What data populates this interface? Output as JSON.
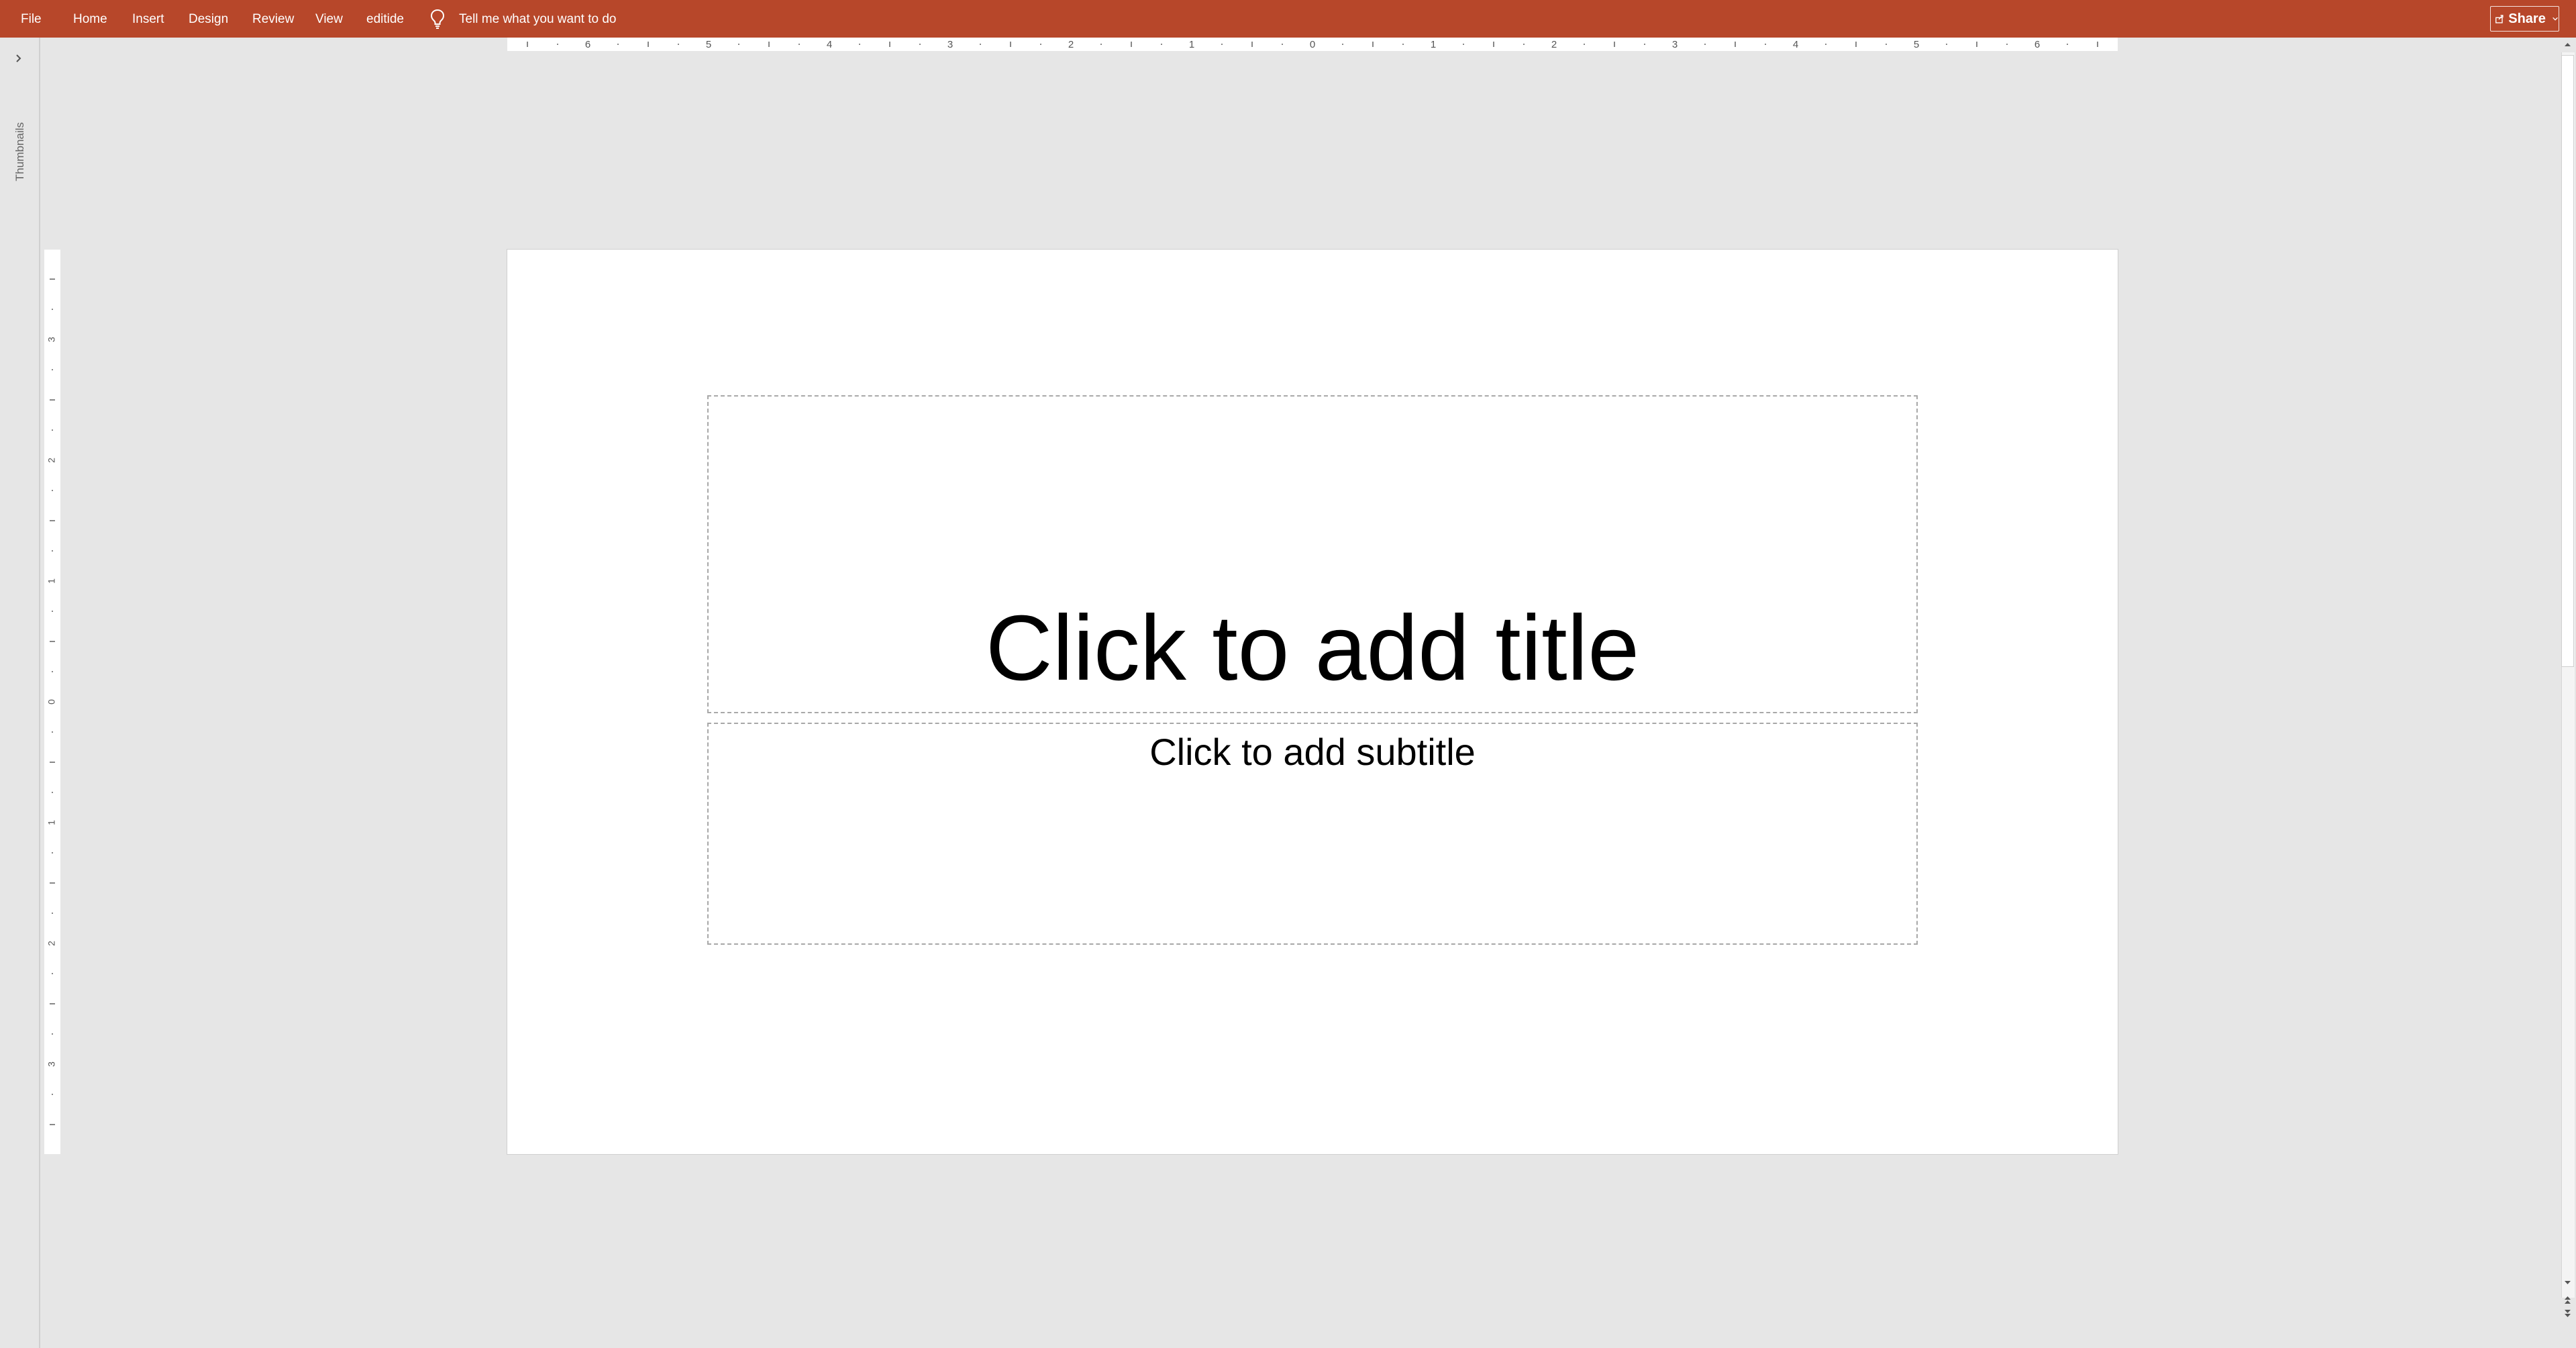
{
  "menu": {
    "file": "File",
    "home": "Home",
    "insert": "Insert",
    "design": "Design",
    "review": "Review",
    "view": "View",
    "editide": "editide"
  },
  "tell_me": {
    "text": "Tell me what you want to do",
    "icon": "lightbulb-icon"
  },
  "share": {
    "label": "Share",
    "icon": "share-icon"
  },
  "thumbnails": {
    "label": "Thumbnails",
    "icon": "chevron-right-icon"
  },
  "ruler": {
    "horizontal_labels": [
      "6",
      "5",
      "4",
      "3",
      "2",
      "1",
      "0",
      "1",
      "2",
      "3",
      "4",
      "5",
      "6"
    ],
    "vertical_labels": [
      "3",
      "2",
      "1",
      "0",
      "1",
      "2",
      "3"
    ]
  },
  "slide": {
    "title_placeholder": "Click to add title",
    "subtitle_placeholder": "Click to add subtitle"
  },
  "colors": {
    "ribbon": "#b7472a",
    "workspace": "#e6e6e6",
    "slide": "#ffffff"
  }
}
